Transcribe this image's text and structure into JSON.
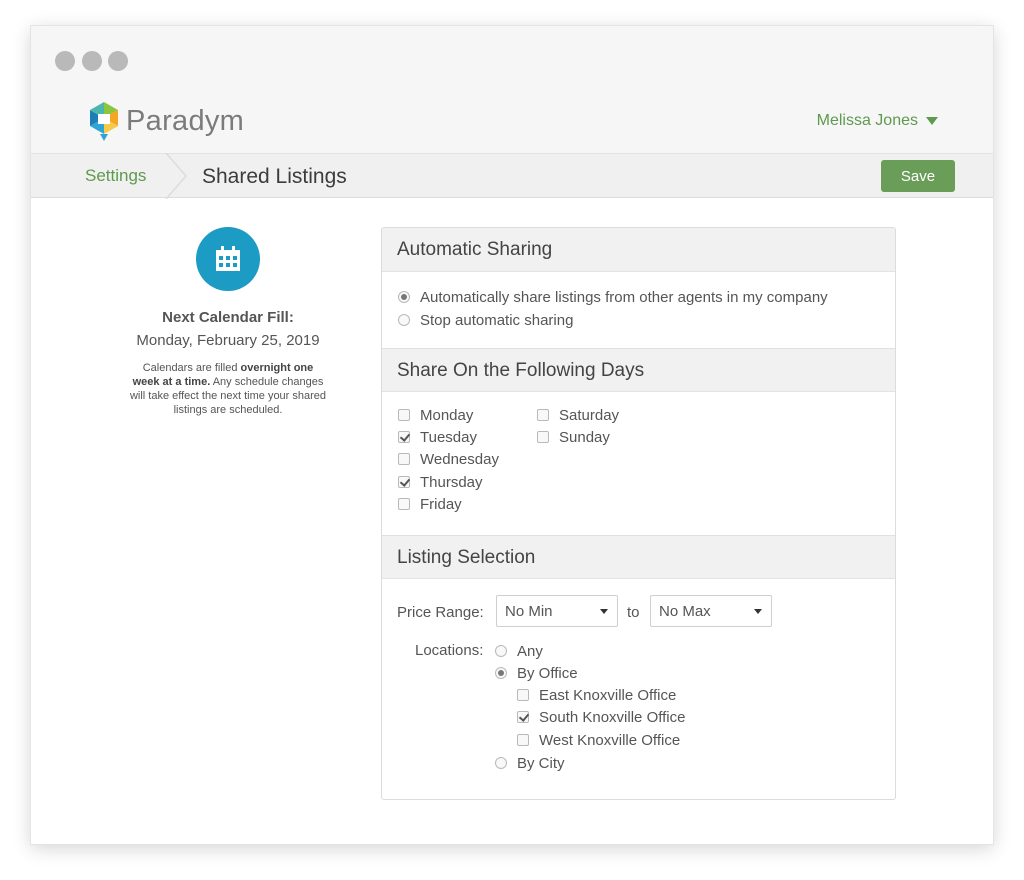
{
  "app": {
    "brand": "Paradym",
    "user_name": "Melissa Jones"
  },
  "colors": {
    "accent_green": "#5d9a4d",
    "save_green": "#6a9e58",
    "calendar_blue": "#1c9bc4"
  },
  "breadcrumb": {
    "parent": "Settings",
    "current": "Shared Listings"
  },
  "toolbar": {
    "save_label": "Save"
  },
  "calendar_fill": {
    "icon": "calendar-icon",
    "title": "Next Calendar Fill:",
    "date": "Monday, February 25, 2019",
    "note_pre": "Calendars are filled ",
    "note_bold": "overnight one week at a time.",
    "note_post": " Any schedule changes will take effect the next time your shared listings are scheduled."
  },
  "automatic_sharing": {
    "title": "Automatic Sharing",
    "options": [
      {
        "label": "Automatically share listings from other agents in my company",
        "selected": true
      },
      {
        "label": "Stop automatic sharing",
        "selected": false
      }
    ]
  },
  "share_days": {
    "title": "Share On the Following Days",
    "days": [
      {
        "label": "Monday",
        "checked": false
      },
      {
        "label": "Tuesday",
        "checked": true
      },
      {
        "label": "Wednesday",
        "checked": false
      },
      {
        "label": "Thursday",
        "checked": true
      },
      {
        "label": "Friday",
        "checked": false
      },
      {
        "label": "Saturday",
        "checked": false
      },
      {
        "label": "Sunday",
        "checked": false
      }
    ]
  },
  "listing_selection": {
    "title": "Listing Selection",
    "price_label": "Price Range:",
    "price_min": "No Min",
    "price_to": "to",
    "price_max": "No Max",
    "locations_label": "Locations:",
    "location_options": [
      {
        "label": "Any",
        "selected": false
      },
      {
        "label": "By Office",
        "selected": true
      },
      {
        "label": "By City",
        "selected": false
      }
    ],
    "offices": [
      {
        "label": "East Knoxville Office",
        "checked": false
      },
      {
        "label": "South Knoxville Office",
        "checked": true
      },
      {
        "label": "West Knoxville Office",
        "checked": false
      }
    ]
  }
}
